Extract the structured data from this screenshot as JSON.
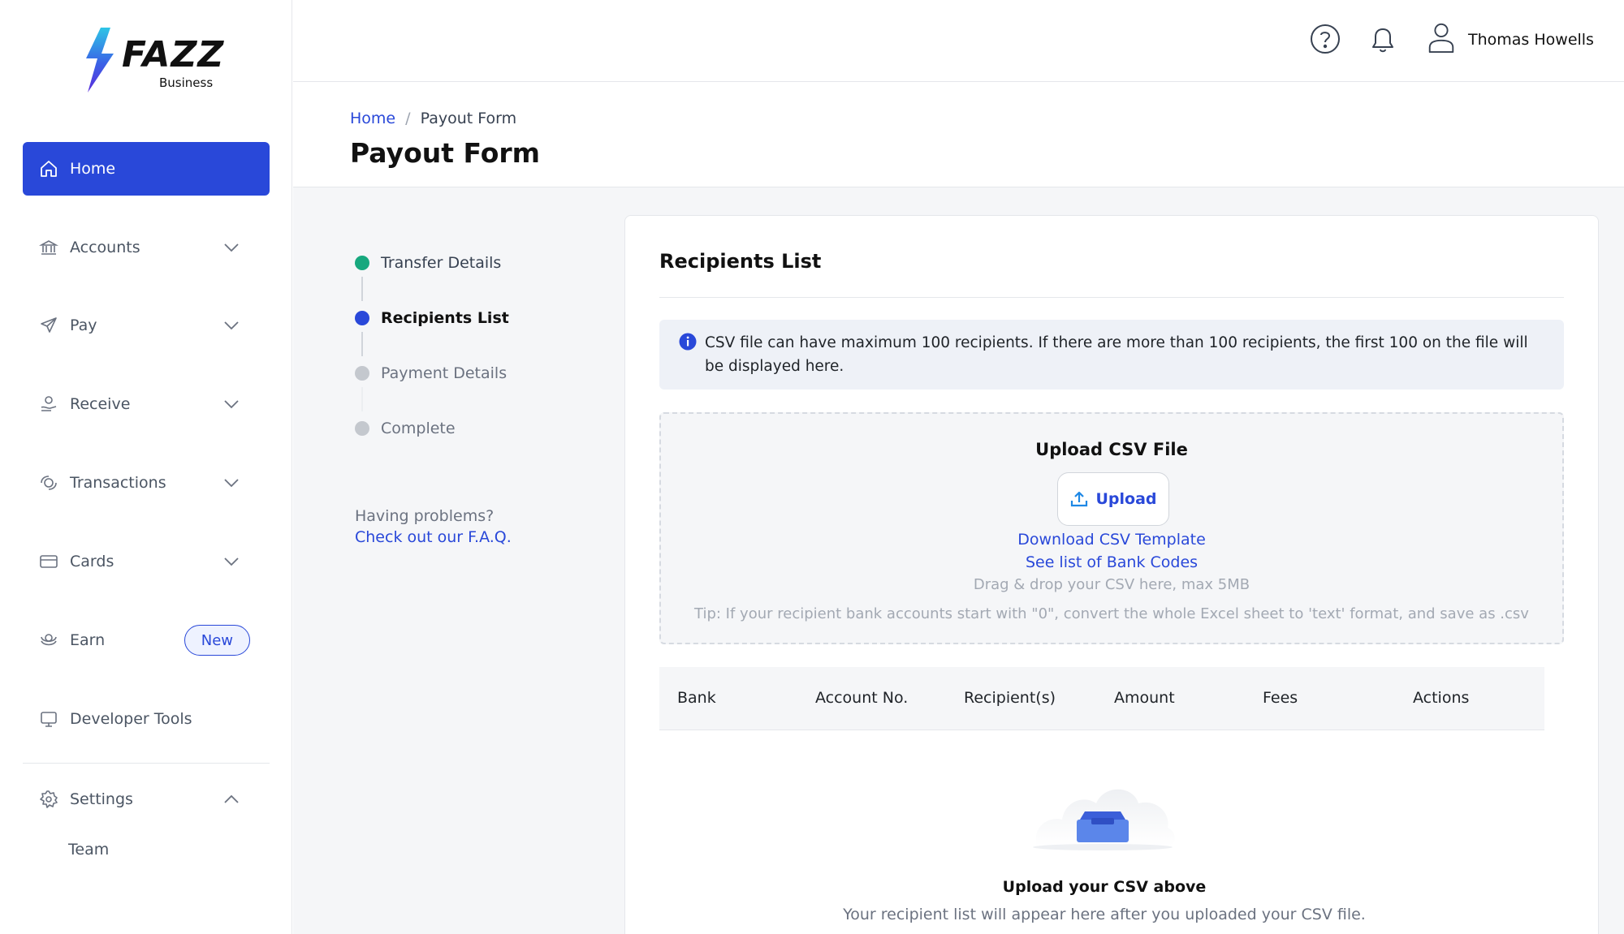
{
  "brand": {
    "name": "FAZZ",
    "sub": "Business",
    "accent": "#2948d9"
  },
  "sidebar": {
    "items": [
      {
        "label": "Home",
        "icon": "home-icon",
        "active": true
      },
      {
        "label": "Accounts",
        "icon": "bank-icon"
      },
      {
        "label": "Pay",
        "icon": "send-icon"
      },
      {
        "label": "Receive",
        "icon": "receive-icon"
      },
      {
        "label": "Transactions",
        "icon": "transactions-icon"
      },
      {
        "label": "Cards",
        "icon": "card-icon"
      },
      {
        "label": "Earn",
        "icon": "earn-icon",
        "badge": "New"
      },
      {
        "label": "Developer Tools",
        "icon": "monitor-icon"
      },
      {
        "label": "Settings",
        "icon": "gear-icon",
        "expanded": true
      }
    ],
    "settings_sub": [
      "Team"
    ]
  },
  "header": {
    "user_name": "Thomas Howells"
  },
  "page": {
    "breadcrumb": {
      "home": "Home",
      "separator": "/",
      "current": "Payout Form"
    },
    "title": "Payout Form"
  },
  "stepper": {
    "steps": [
      {
        "label": "Transfer Details",
        "state": "done"
      },
      {
        "label": "Recipients List",
        "state": "current"
      },
      {
        "label": "Payment Details",
        "state": "pending"
      },
      {
        "label": "Complete",
        "state": "pending"
      }
    ],
    "help_text": "Having problems?",
    "faq_link": "Check out our F.A.Q."
  },
  "recipients": {
    "title": "Recipients List",
    "info": "CSV file can have maximum 100 recipients. If there are more than 100 recipients, the first 100 on the file will be displayed here.",
    "upload": {
      "title": "Upload CSV File",
      "button": "Upload",
      "template_link": "Download CSV Template",
      "bank_codes_link": "See list of Bank Codes",
      "drag_hint": "Drag & drop your CSV here, max 5MB",
      "tip": "Tip: If your recipient bank accounts start with \"0\", convert the whole Excel sheet to 'text' format, and save as .csv"
    },
    "table": {
      "columns": [
        "Bank",
        "Account No.",
        "Recipient(s)",
        "Amount",
        "Fees",
        "Actions"
      ]
    },
    "empty": {
      "title": "Upload your CSV above",
      "subtitle": "Your recipient list will appear here after you uploaded your CSV file."
    }
  }
}
